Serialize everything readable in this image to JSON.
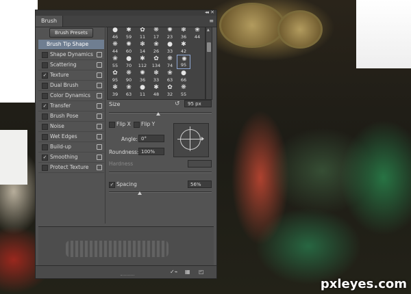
{
  "window": {
    "tab_title": "Brush"
  },
  "left_panel": {
    "presets_button": "Brush Presets",
    "items": [
      {
        "label": "Brush Tip Shape",
        "selected": true,
        "checked": null,
        "lock": false
      },
      {
        "label": "Shape Dynamics",
        "checked": false,
        "lock": true
      },
      {
        "label": "Scattering",
        "checked": false,
        "lock": true
      },
      {
        "label": "Texture",
        "checked": true,
        "lock": true
      },
      {
        "label": "Dual Brush",
        "checked": false,
        "lock": true
      },
      {
        "label": "Color Dynamics",
        "checked": false,
        "lock": true
      },
      {
        "label": "Transfer",
        "checked": true,
        "lock": true
      },
      {
        "label": "Brush Pose",
        "checked": false,
        "lock": true
      },
      {
        "label": "Noise",
        "checked": false,
        "lock": true
      },
      {
        "label": "Wet Edges",
        "checked": false,
        "lock": true
      },
      {
        "label": "Build-up",
        "checked": false,
        "lock": true
      },
      {
        "label": "Smoothing",
        "checked": true,
        "lock": true
      },
      {
        "label": "Protect Texture",
        "checked": false,
        "lock": true
      }
    ]
  },
  "brush_grid": {
    "rows": [
      [
        "46",
        "59",
        "11",
        "17",
        "23",
        "36",
        "44"
      ],
      [
        "44",
        "60",
        "14",
        "26",
        "33",
        "42",
        ""
      ],
      [
        "55",
        "70",
        "112",
        "134",
        "74",
        "95",
        ""
      ],
      [
        "95",
        "90",
        "36",
        "33",
        "63",
        "66",
        ""
      ],
      [
        "39",
        "63",
        "11",
        "48",
        "32",
        "55",
        ""
      ]
    ],
    "selected": {
      "row": 2,
      "col": 5
    }
  },
  "tip_settings": {
    "size_label": "Size",
    "size_value": "95 px",
    "size_fraction": 0.48,
    "flip_x": "Flip X",
    "flip_y": "Flip Y",
    "angle_label": "Angle:",
    "angle_value": "0°",
    "roundness_label": "Roundness:",
    "roundness_value": "100%",
    "hardness_label": "Hardness",
    "spacing_label": "Spacing",
    "spacing_checked": true,
    "spacing_value": "56%",
    "spacing_fraction": 0.3
  },
  "watermark": "pxleyes.com",
  "colors": {
    "panel": "#535353",
    "selection": "#6f7e91"
  }
}
